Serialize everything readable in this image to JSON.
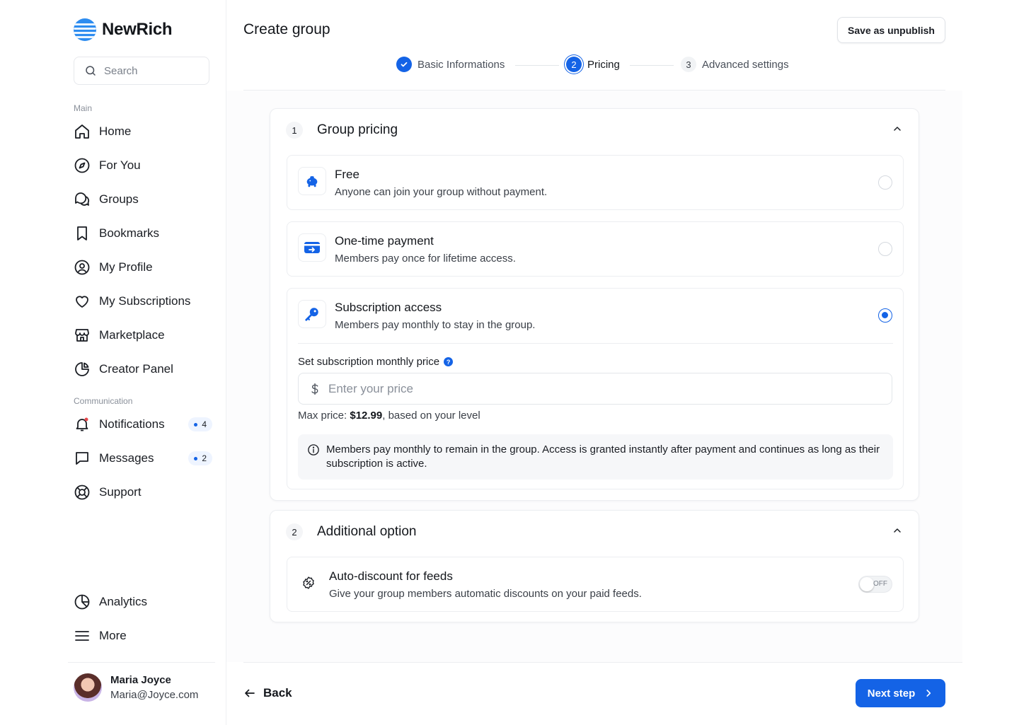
{
  "brand": {
    "name": "NewRich",
    "accent": "#1463e6"
  },
  "sidebar": {
    "search_placeholder": "Search",
    "main_label": "Main",
    "main_items": [
      {
        "label": "Home",
        "icon": "home-icon"
      },
      {
        "label": "For You",
        "icon": "compass-icon"
      },
      {
        "label": "Groups",
        "icon": "chat-bubbles-icon"
      },
      {
        "label": "Bookmarks",
        "icon": "bookmark-icon"
      },
      {
        "label": "My Profile",
        "icon": "user-circle-icon"
      },
      {
        "label": "My Subscriptions",
        "icon": "heart-icon"
      },
      {
        "label": "Marketplace",
        "icon": "store-icon"
      },
      {
        "label": "Creator Panel",
        "icon": "pie-chart-icon"
      }
    ],
    "communication_label": "Communication",
    "communication_items": [
      {
        "label": "Notifications",
        "icon": "bell-icon",
        "count": "4"
      },
      {
        "label": "Messages",
        "icon": "message-icon",
        "count": "2"
      },
      {
        "label": "Support",
        "icon": "lifebuoy-icon"
      }
    ],
    "bottom_items": [
      {
        "label": "Analytics",
        "icon": "analytics-icon"
      },
      {
        "label": "More",
        "icon": "menu-icon"
      }
    ],
    "user": {
      "name": "Maria Joyce",
      "email": "Maria@Joyce.com"
    }
  },
  "header": {
    "title": "Create group",
    "save_label": "Save as unpublish"
  },
  "stepper": {
    "steps": [
      {
        "number": "1",
        "label": "Basic Informations",
        "state": "done"
      },
      {
        "number": "2",
        "label": "Pricing",
        "state": "active"
      },
      {
        "number": "3",
        "label": "Advanced settings",
        "state": "todo"
      }
    ]
  },
  "group_pricing": {
    "number": "1",
    "title": "Group pricing",
    "options": [
      {
        "title": "Free",
        "description": "Anyone can join your group without payment.",
        "icon": "piggy-bank-icon",
        "selected": false
      },
      {
        "title": "One-time payment",
        "description": "Members pay once for lifetime access.",
        "icon": "card-transfer-icon",
        "selected": false
      },
      {
        "title": "Subscription access",
        "description": "Members pay monthly to stay in the group.",
        "icon": "key-icon",
        "selected": true
      }
    ],
    "price_label": "Set subscription monthly price",
    "price_value": "",
    "price_placeholder": "Enter your price",
    "max_price_prefix": "Max price: ",
    "max_price_value": "$12.99",
    "max_price_suffix": ", based on your level",
    "info_text": "Members pay monthly to remain in the group. Access is granted instantly after payment and continues as long as their subscription is active."
  },
  "additional": {
    "number": "2",
    "title": "Additional option",
    "auto_discount_title": "Auto-discount for feeds",
    "auto_discount_desc": "Give your group members automatic discounts on your paid feeds.",
    "toggle_label": "OFF",
    "toggle_on": false
  },
  "footer": {
    "back_label": "Back",
    "next_label": "Next step"
  }
}
